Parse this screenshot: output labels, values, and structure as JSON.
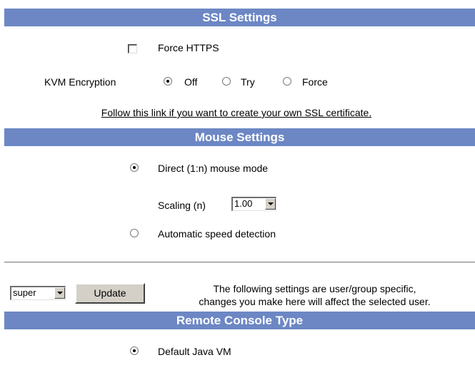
{
  "ssl": {
    "title": "SSL Settings",
    "force_https_label": "Force HTTPS",
    "force_https_checked": false,
    "kvm_label": "KVM Encryption",
    "kvm_options": [
      "Off",
      "Try",
      "Force"
    ],
    "kvm_selected": "Off",
    "cert_link": "Follow this link if you want to create your own SSL certificate."
  },
  "mouse": {
    "title": "Mouse Settings",
    "direct_label": "Direct (1:n) mouse mode",
    "direct_selected": true,
    "scaling_label": "Scaling (n)",
    "scaling_value": "1.00",
    "auto_label": "Automatic speed detection",
    "auto_selected": false
  },
  "user_select": {
    "value": "super",
    "update_label": "Update",
    "note_line1": "The following settings are user/group specific,",
    "note_line2": "changes you make here will affect the selected user."
  },
  "console": {
    "title": "Remote Console Type",
    "default_java_label": "Default Java VM",
    "default_java_selected": true
  }
}
